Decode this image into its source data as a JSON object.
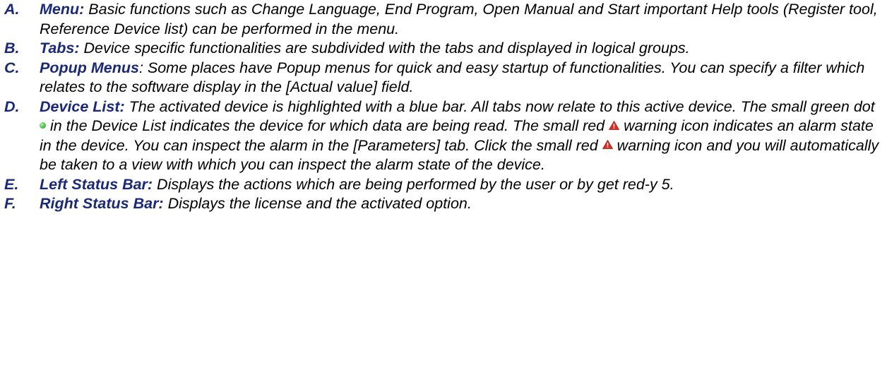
{
  "items": [
    {
      "letter": "A.",
      "term": "Menu:",
      "text": " Basic functions such as Change Language, End Program, Open Manual and Start important Help tools (Register tool, Reference Device list) can be performed in the menu."
    },
    {
      "letter": "B.",
      "term": "Tabs:",
      "text": " Device specific functionalities are subdivided with the tabs and displayed in logical groups."
    },
    {
      "letter": "C.",
      "term": "Popup Menus",
      "text": ": Some places have Popup menus for quick and easy startup of functionalities. You can specify a filter which relates to the software display in the [Actual value] field."
    },
    {
      "letter": "D.",
      "term": "Device List:",
      "text_1": " The activated device is highlighted with a blue bar. All tabs now relate to this active device. The small green dot ",
      "text_2": " in the Device List indicates the device for which data are being read. The small red ",
      "text_3": " warning icon indicates an alarm state in the device. You can inspect the alarm in the [Parameters] tab. Click the small red ",
      "text_4": " warning icon and you will automatically be taken to a view with which you can inspect the alarm state of the device."
    },
    {
      "letter": "E.",
      "term": "Left Status Bar:",
      "text": " Displays the actions which are being performed by the user or by get red-y 5."
    },
    {
      "letter": "F.",
      "term": "Right Status Bar:",
      "text": " Displays the license and the activated option."
    }
  ],
  "icons": {
    "dot": "green-dot-icon",
    "warning": "red-warning-icon"
  },
  "colors": {
    "term": "#1a2a78",
    "dot": "#4cc04a",
    "warning": "#d93025"
  }
}
